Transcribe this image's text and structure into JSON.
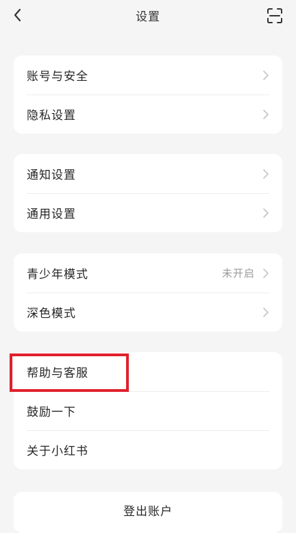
{
  "header": {
    "title": "设置"
  },
  "groups": [
    {
      "items": [
        {
          "label": "账号与安全"
        },
        {
          "label": "隐私设置"
        }
      ]
    },
    {
      "items": [
        {
          "label": "通知设置"
        },
        {
          "label": "通用设置"
        }
      ]
    },
    {
      "items": [
        {
          "label": "青少年模式",
          "value": "未开启"
        },
        {
          "label": "深色模式"
        }
      ]
    },
    {
      "items": [
        {
          "label": "帮助与客服"
        },
        {
          "label": "鼓励一下"
        },
        {
          "label": "关于小红书"
        }
      ]
    }
  ],
  "footer": {
    "logout_label": "登出账户"
  },
  "colors": {
    "background": "#f5f5f5",
    "card": "#ffffff",
    "highlight_border": "#e0202b",
    "secondary_text": "#9a9a9a"
  },
  "icons": {
    "back": "chevron-left-icon",
    "scan": "scan-icon",
    "row_arrow": "chevron-right-icon"
  }
}
